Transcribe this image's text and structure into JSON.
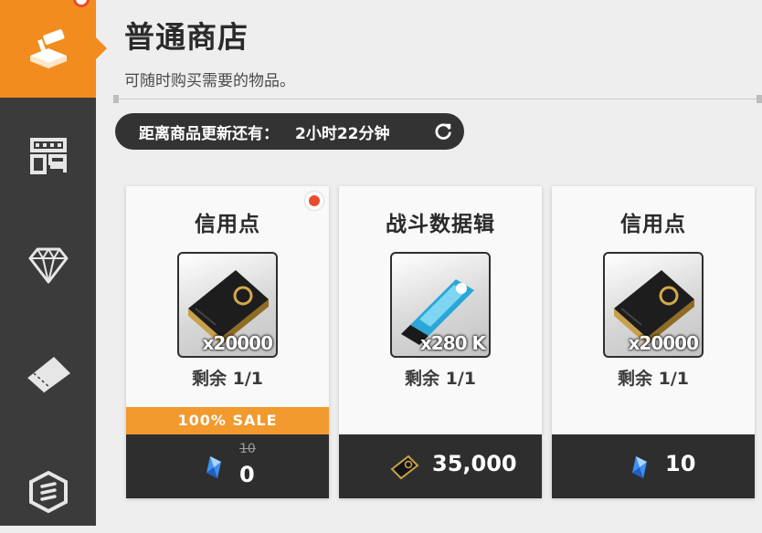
{
  "sidebar": {
    "items": [
      {
        "icon": "hammer-shop-icon",
        "active": true
      },
      {
        "icon": "grid-shop-icon",
        "active": false
      },
      {
        "icon": "diamond-icon",
        "active": false
      },
      {
        "icon": "ticket-icon",
        "active": false
      },
      {
        "icon": "hexagon-badge-icon",
        "active": false
      }
    ]
  },
  "header": {
    "title": "普通商店",
    "subtitle": "可随时购买需要的物品。"
  },
  "timer": {
    "label": "距离商品更新还有：",
    "value": "2小时22分钟"
  },
  "cards": [
    {
      "name": "信用点",
      "item_icon": "credit-card-icon",
      "quantity": "x20000",
      "remaining": "剩余 1/1",
      "sale_label": "100% SALE",
      "old_price": "10",
      "price": "0",
      "currency_icon": "blue-crystal-icon",
      "new_badge": true
    },
    {
      "name": "战斗数据辑",
      "item_icon": "usb-drive-icon",
      "quantity": "x280 K",
      "remaining": "剩余 1/1",
      "price": "35,000",
      "currency_icon": "credit-card-icon"
    },
    {
      "name": "信用点",
      "item_icon": "credit-card-icon",
      "quantity": "x20000",
      "remaining": "剩余 1/1",
      "price": "10",
      "currency_icon": "blue-crystal-icon"
    }
  ],
  "colors": {
    "accent": "#f28c1e",
    "sidebar": "#3b3b3b",
    "price_bar": "#2e2e2e",
    "sale": "#f29a2e",
    "notification": "#ea4b2a"
  }
}
